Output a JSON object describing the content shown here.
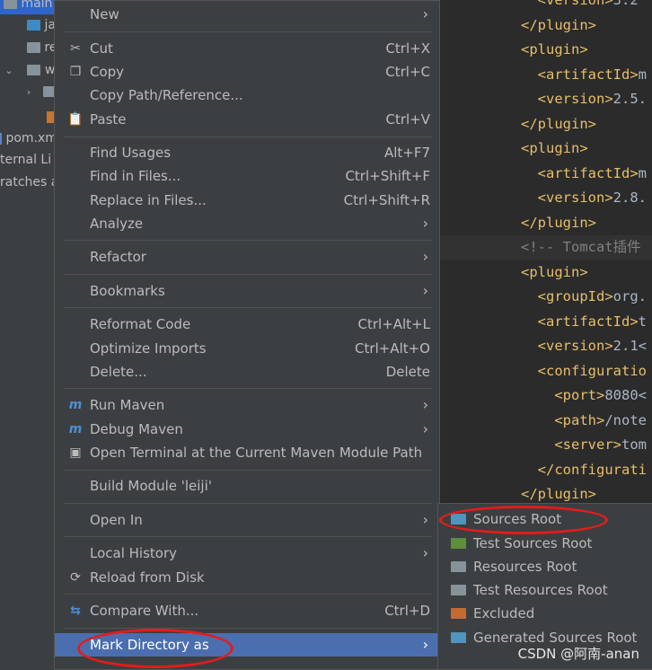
{
  "project_tree": {
    "rows": [
      {
        "label": "main",
        "icon": "folder-icon"
      },
      {
        "label": "ja",
        "icon": "folder-icon"
      },
      {
        "label": "re",
        "icon": "folder-icon"
      },
      {
        "label": "w",
        "icon": "folder-icon"
      },
      {
        "label": "",
        "icon": "folder-icon"
      },
      {
        "label": "",
        "icon": "file-icon"
      },
      {
        "label": "pom.xm",
        "icon": "maven-file-icon"
      },
      {
        "label": "ternal Li",
        "icon": ""
      },
      {
        "label": "ratches a",
        "icon": ""
      }
    ]
  },
  "editor": {
    "lines": [
      {
        "indent": "  ",
        "open": "<version>",
        "text": "3.2",
        "kind": "tag"
      },
      {
        "indent": "",
        "open": "</plugin>",
        "text": "",
        "kind": "tag"
      },
      {
        "indent": "",
        "open": "<plugin>",
        "text": "",
        "kind": "tag"
      },
      {
        "indent": "  ",
        "open": "<artifactId>",
        "text": "m",
        "kind": "tag"
      },
      {
        "indent": "  ",
        "open": "<version>",
        "text": "2.5.",
        "kind": "tag"
      },
      {
        "indent": "",
        "open": "</plugin>",
        "text": "",
        "kind": "tag"
      },
      {
        "indent": "",
        "open": "<plugin>",
        "text": "",
        "kind": "tag"
      },
      {
        "indent": "  ",
        "open": "<artifactId>",
        "text": "m",
        "kind": "tag"
      },
      {
        "indent": "  ",
        "open": "<version>",
        "text": "2.8.",
        "kind": "tag"
      },
      {
        "indent": "",
        "open": "</plugin>",
        "text": "",
        "kind": "tag"
      },
      {
        "indent": "",
        "open": "<!-- Tomcat插件",
        "text": "",
        "kind": "comment"
      },
      {
        "indent": "",
        "open": "<plugin>",
        "text": "",
        "kind": "tag"
      },
      {
        "indent": "  ",
        "open": "<groupId>",
        "text": "org.",
        "kind": "tag"
      },
      {
        "indent": "  ",
        "open": "<artifactId>",
        "text": "t",
        "kind": "tag"
      },
      {
        "indent": "  ",
        "open": "<version>",
        "text": "2.1<",
        "kind": "tag"
      },
      {
        "indent": "  ",
        "open": "<configuratio",
        "text": "",
        "kind": "tag"
      },
      {
        "indent": "    ",
        "open": "<port>",
        "text": "8080<",
        "kind": "tag"
      },
      {
        "indent": "    ",
        "open": "<path>",
        "text": "/note",
        "kind": "tag"
      },
      {
        "indent": "    ",
        "open": "<server>",
        "text": "tom",
        "kind": "tag"
      },
      {
        "indent": "  ",
        "open": "</configurati",
        "text": "",
        "kind": "tag"
      },
      {
        "indent": "",
        "open": "</plugin>",
        "text": "",
        "kind": "tag"
      }
    ]
  },
  "context_menu": {
    "items": [
      {
        "name": "new",
        "label": "New",
        "shortcut": "",
        "submenu": true,
        "icon": ""
      },
      {
        "sep": true
      },
      {
        "name": "cut",
        "label": "Cut",
        "shortcut": "Ctrl+X",
        "icon": "scissors-icon"
      },
      {
        "name": "copy",
        "label": "Copy",
        "shortcut": "Ctrl+C",
        "icon": "copy-icon"
      },
      {
        "name": "copy-path",
        "label": "Copy Path/Reference...",
        "shortcut": "",
        "icon": ""
      },
      {
        "name": "paste",
        "label": "Paste",
        "shortcut": "Ctrl+V",
        "icon": "clipboard-icon"
      },
      {
        "sep": true
      },
      {
        "name": "find-usages",
        "label": "Find Usages",
        "shortcut": "Alt+F7",
        "icon": ""
      },
      {
        "name": "find-in-files",
        "label": "Find in Files...",
        "shortcut": "Ctrl+Shift+F",
        "icon": ""
      },
      {
        "name": "replace-in-files",
        "label": "Replace in Files...",
        "shortcut": "Ctrl+Shift+R",
        "icon": ""
      },
      {
        "name": "analyze",
        "label": "Analyze",
        "shortcut": "",
        "submenu": true,
        "icon": ""
      },
      {
        "sep": true
      },
      {
        "name": "refactor",
        "label": "Refactor",
        "shortcut": "",
        "submenu": true,
        "icon": ""
      },
      {
        "sep": true
      },
      {
        "name": "bookmarks",
        "label": "Bookmarks",
        "shortcut": "",
        "submenu": true,
        "icon": ""
      },
      {
        "sep": true
      },
      {
        "name": "reformat-code",
        "label": "Reformat Code",
        "shortcut": "Ctrl+Alt+L",
        "icon": ""
      },
      {
        "name": "optimize-imports",
        "label": "Optimize Imports",
        "shortcut": "Ctrl+Alt+O",
        "icon": ""
      },
      {
        "name": "delete",
        "label": "Delete...",
        "shortcut": "Delete",
        "icon": ""
      },
      {
        "sep": true
      },
      {
        "name": "run-maven",
        "label": "Run Maven",
        "shortcut": "",
        "submenu": true,
        "icon": "maven-run-icon"
      },
      {
        "name": "debug-maven",
        "label": "Debug Maven",
        "shortcut": "",
        "submenu": true,
        "icon": "maven-debug-icon"
      },
      {
        "name": "open-terminal",
        "label": "Open Terminal at the Current Maven Module Path",
        "shortcut": "",
        "icon": "terminal-icon"
      },
      {
        "sep": true
      },
      {
        "name": "build-module",
        "label": "Build Module 'leiji'",
        "shortcut": "",
        "icon": ""
      },
      {
        "sep": true
      },
      {
        "name": "open-in",
        "label": "Open In",
        "shortcut": "",
        "submenu": true,
        "icon": ""
      },
      {
        "sep": true
      },
      {
        "name": "local-history",
        "label": "Local History",
        "shortcut": "",
        "submenu": true,
        "icon": ""
      },
      {
        "name": "reload-from-disk",
        "label": "Reload from Disk",
        "shortcut": "",
        "icon": "reload-icon"
      },
      {
        "sep": true
      },
      {
        "name": "compare-with",
        "label": "Compare With...",
        "shortcut": "Ctrl+D",
        "icon": "compare-icon"
      },
      {
        "sep": true
      },
      {
        "name": "mark-directory-as",
        "label": "Mark Directory as",
        "shortcut": "",
        "submenu": true,
        "icon": "",
        "selected": true
      }
    ]
  },
  "submenu": {
    "items": [
      {
        "name": "sources-root",
        "label": "Sources Root",
        "icon_color": "#4f95bd"
      },
      {
        "name": "test-sources-root",
        "label": "Test Sources Root",
        "icon_color": "#5e8f3b"
      },
      {
        "name": "resources-root",
        "label": "Resources Root",
        "icon_color": "#87939a"
      },
      {
        "name": "test-resources-root",
        "label": "Test Resources Root",
        "icon_color": "#87939a"
      },
      {
        "name": "excluded",
        "label": "Excluded",
        "icon_color": "#c56b32"
      },
      {
        "name": "generated-sources-root",
        "label": "Generated Sources Root",
        "icon_color": "#4f95bd"
      }
    ]
  },
  "watermark": "CSDN @阿南-anan",
  "colors": {
    "selection": "#4b6eaf",
    "annotation": "#e31c1c",
    "menu_bg": "#3c3f41"
  }
}
